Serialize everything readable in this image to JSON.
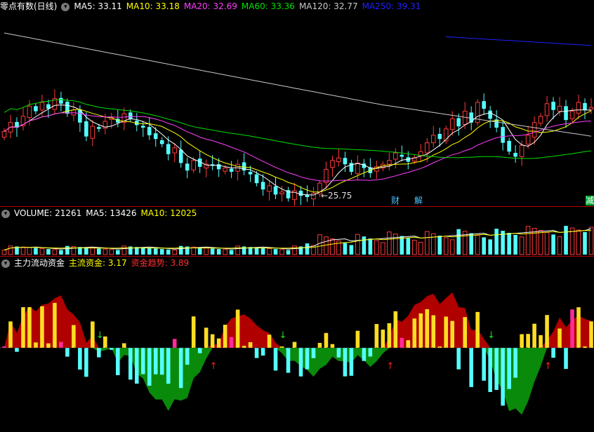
{
  "main_panel": {
    "title": "零点有数(日线)",
    "ma": [
      {
        "label": "MA5: 33.11",
        "color": "#ffffff"
      },
      {
        "label": "MA10: 33.18",
        "color": "#ffff00"
      },
      {
        "label": "MA20: 32.69",
        "color": "#ff40ff"
      },
      {
        "label": "MA60: 33.36",
        "color": "#00e000"
      },
      {
        "label": "MA120: 32.77",
        "color": "#c8c8c8"
      },
      {
        "label": "MA250: 39.31",
        "color": "#2020ff"
      }
    ],
    "low_label": "←25.75",
    "tags": [
      "财",
      "解",
      "减"
    ]
  },
  "volume_panel": {
    "labels": [
      {
        "label": "VOLUME: 21261",
        "color": "#ffffff"
      },
      {
        "label": "MA5: 13426",
        "color": "#ffffff"
      },
      {
        "label": "MA10: 12025",
        "color": "#ffff00"
      }
    ]
  },
  "flow_panel": {
    "labels": [
      {
        "label": "主力流动资金",
        "color": "#ffffff"
      },
      {
        "label": "主流资金: 3.17",
        "color": "#ffff00"
      },
      {
        "label": "资金趋势: 3.89",
        "color": "#ff3030"
      }
    ]
  },
  "chart_data": {
    "type": "candlestick",
    "closes": [
      31.2,
      31.9,
      31.5,
      32.4,
      33.2,
      32.8,
      33.5,
      33.0,
      33.8,
      33.4,
      32.6,
      32.9,
      31.9,
      30.8,
      31.6,
      31.4,
      32.0,
      32.3,
      31.9,
      32.6,
      32.2,
      31.7,
      31.5,
      30.9,
      30.6,
      30.2,
      29.4,
      29.9,
      28.7,
      28.1,
      28.9,
      28.4,
      28.6,
      28.5,
      28.2,
      28.3,
      28.0,
      28.6,
      28.1,
      27.8,
      27.1,
      26.6,
      26.9,
      26.2,
      26.4,
      25.9,
      26.5,
      26.1,
      26.0,
      26.3,
      27.1,
      28.2,
      28.9,
      29.1,
      28.6,
      28.0,
      28.7,
      28.3,
      27.9,
      28.4,
      28.6,
      28.9,
      29.5,
      29.2,
      28.8,
      29.1,
      29.6,
      30.3,
      30.9,
      30.6,
      31.4,
      32.2,
      31.6,
      32.8,
      31.9,
      33.5,
      33.0,
      32.2,
      31.5,
      30.3,
      29.6,
      29.2,
      30.1,
      30.9,
      31.9,
      32.4,
      33.4,
      32.9,
      33.2,
      32.1,
      32.8,
      33.5,
      32.9,
      33.1
    ],
    "price_range": [
      25.5,
      40.5
    ],
    "low_value": 25.75,
    "volume_max": 24000,
    "volumes_approx_last": 21261
  }
}
